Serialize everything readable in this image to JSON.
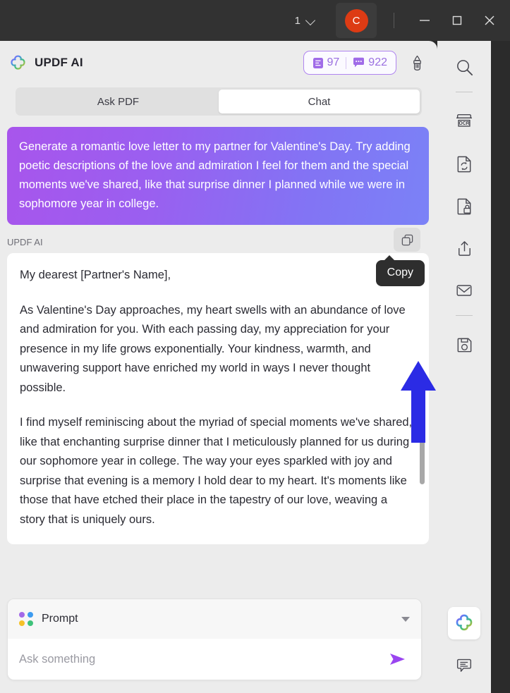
{
  "titlebar": {
    "page_number": "1",
    "page_dropdown_icon": "chevron-down-icon",
    "avatar_initial": "C",
    "avatar_color": "#dd3b14",
    "minimize_label": "Minimize",
    "maximize_label": "Maximize",
    "close_label": "Close"
  },
  "panel": {
    "brand_title": "UPDF AI",
    "brand_icon": "updf-ai-clover-logo",
    "credits": {
      "document_icon": "document-credit-icon",
      "document_count": "97",
      "chat_icon": "chat-credit-icon",
      "chat_count": "922",
      "border_color": "#b085f0",
      "text_color": "#9a6fe0"
    },
    "brush_icon": "brush-clear-icon",
    "tabs": [
      {
        "label": "Ask PDF",
        "active": false
      },
      {
        "label": "Chat",
        "active": true
      }
    ]
  },
  "conversation": {
    "user_message": "Generate a romantic love letter to my partner for Valentine's Day. Try adding poetic descriptions of the love and admiration I feel for them and the special moments we've shared, like that surprise dinner I planned while we were in sophomore year in college.",
    "user_bubble_gradient_from": "#a855ec",
    "user_bubble_gradient_to": "#7b82f7",
    "assistant_name": "UPDF AI",
    "copy_button_icon": "copy-icon",
    "copy_tooltip": "Copy",
    "assistant_paragraphs": [
      "My dearest [Partner's Name],",
      "As Valentine's Day approaches, my heart swells with an abundance of love and admiration for you. With each passing day, my appreciation for your presence in my life grows exponentially. Your kindness, warmth, and unwavering support have enriched my world in ways I never thought possible.",
      "I find myself reminiscing about the myriad of special moments we've shared, like that enchanting surprise dinner that I meticulously planned for us during our sophomore year in college. The way your eyes sparkled with joy and surprise that evening is a memory I hold dear to my heart. It's moments like those that have etched their place in the tapestry of our love, weaving a story that is uniquely ours."
    ],
    "annotation_arrow_color": "#2b2be5"
  },
  "composer": {
    "prompt_label": "Prompt",
    "prompt_icon": "four-dots-prompt-icon",
    "prompt_dot_colors": [
      "#a36ae8",
      "#3d9bf0",
      "#f5c128",
      "#3fc27a"
    ],
    "dropdown_icon": "caret-down-icon",
    "input_value": "",
    "input_placeholder": "Ask something",
    "send_icon": "send-arrow-icon",
    "send_color": "#9a45f0"
  },
  "rail": {
    "items": [
      {
        "name": "search-icon",
        "label": "Search",
        "active": false
      },
      {
        "name": "ocr-icon",
        "label": "OCR",
        "active": false
      },
      {
        "name": "convert-document-icon",
        "label": "Convert",
        "active": false
      },
      {
        "name": "protect-document-icon",
        "label": "Protect",
        "active": false
      },
      {
        "name": "share-icon",
        "label": "Share",
        "active": false
      },
      {
        "name": "mail-icon",
        "label": "Email",
        "active": false
      },
      {
        "name": "save-icon",
        "label": "Save",
        "active": false
      },
      {
        "name": "updf-ai-icon",
        "label": "UPDF AI",
        "active": true
      },
      {
        "name": "comment-icon",
        "label": "Comment",
        "active": false
      }
    ]
  }
}
